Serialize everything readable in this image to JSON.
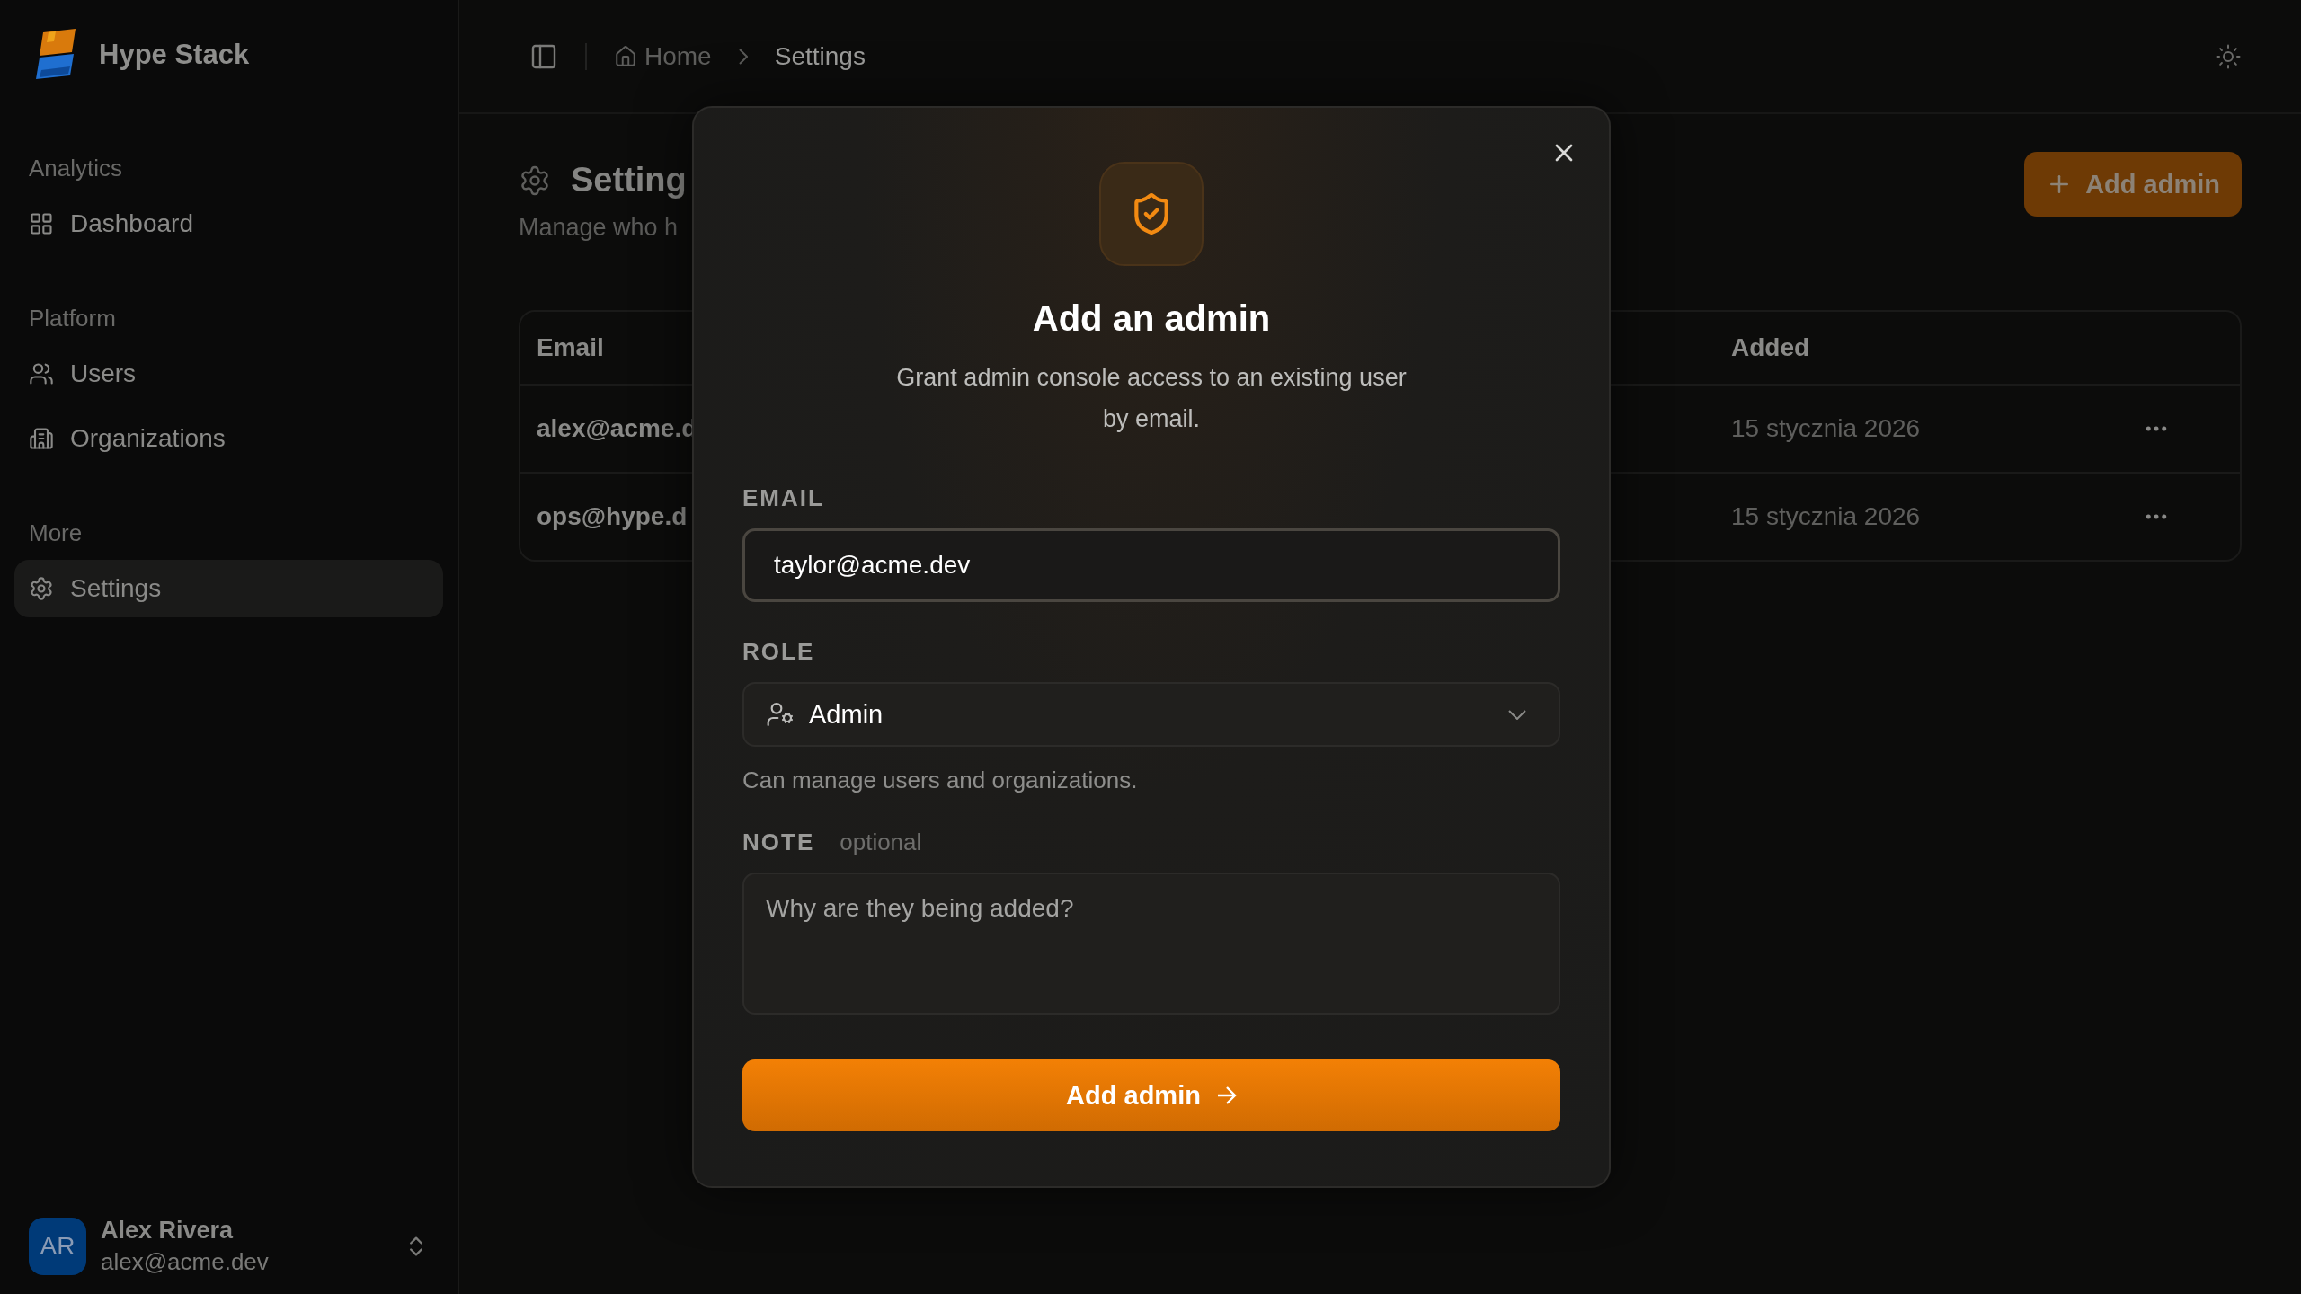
{
  "sidebar": {
    "brand": "Hype Stack",
    "sections": [
      {
        "title": "Analytics",
        "items": [
          {
            "label": "Dashboard",
            "kind": "dashboard",
            "selected": false
          }
        ]
      },
      {
        "title": "Platform",
        "items": [
          {
            "label": "Users",
            "kind": "users",
            "selected": false
          },
          {
            "label": "Organizations",
            "kind": "building",
            "selected": false
          }
        ]
      },
      {
        "title": "More",
        "items": [
          {
            "label": "Settings",
            "kind": "settings",
            "selected": true
          }
        ]
      }
    ],
    "user": {
      "initials": "AR",
      "name": "Alex Rivera",
      "email": "alex@acme.dev"
    }
  },
  "header": {
    "breadcrumbs": [
      {
        "label": "Home",
        "current": false
      },
      {
        "label": "Settings",
        "current": true
      }
    ]
  },
  "page": {
    "title": "Setting",
    "subtitle": "Manage who h",
    "add_button": "Add admin",
    "table": {
      "columns": [
        "Email",
        "Added"
      ],
      "rows": [
        {
          "email": "alex@acme.d",
          "added": "15 stycznia 2026"
        },
        {
          "email": "ops@hype.d",
          "added": "15 stycznia 2026"
        }
      ]
    }
  },
  "dialog": {
    "title": "Add an admin",
    "description": "Grant admin console access to an existing user by email.",
    "email": {
      "label": "EMAIL",
      "value": "taylor@acme.dev"
    },
    "role": {
      "label": "ROLE",
      "value": "Admin",
      "help": "Can manage users and organizations."
    },
    "note": {
      "label": "NOTE",
      "hint": "optional",
      "placeholder": "Why are they being added?"
    },
    "submit": "Add admin"
  }
}
